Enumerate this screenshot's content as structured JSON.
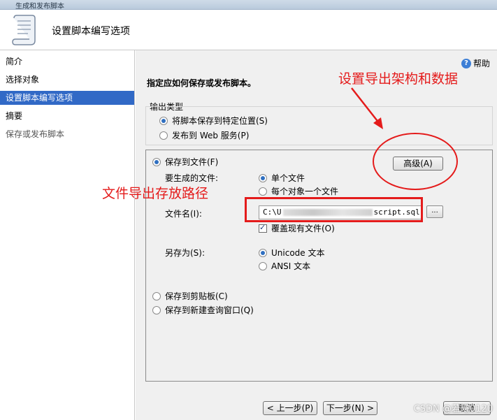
{
  "window": {
    "title": "生成和发布脚本"
  },
  "header": {
    "title": "设置脚本编写选项"
  },
  "sidebar": {
    "items": [
      {
        "label": "简介"
      },
      {
        "label": "选择对象"
      },
      {
        "label": "设置脚本编写选项"
      },
      {
        "label": "摘要"
      },
      {
        "label": "保存或发布脚本"
      }
    ]
  },
  "main": {
    "help_label": "帮助",
    "instruction": "指定应如何保存或发布脚本。",
    "output_type": {
      "label": "输出类型",
      "option_save": "将脚本保存到特定位置(S)",
      "option_publish": "发布到 Web 服务(P)"
    },
    "save_to_file": "保存到文件(F)",
    "advanced_button": "高级(A)",
    "files_to_generate_label": "要生成的文件:",
    "single_file": "单个文件",
    "file_per_object": "每个对象一个文件",
    "filename_label": "文件名(I):",
    "filename_value_start": "C:\\U",
    "filename_value_end": "script.sql",
    "browse_button": "...",
    "overwrite_label": "覆盖现有文件(O)",
    "save_as_label": "另存为(S):",
    "unicode_option": "Unicode 文本",
    "ansi_option": "ANSI 文本",
    "save_clipboard": "保存到剪贴板(C)",
    "save_new_query": "保存到新建查询窗口(Q)"
  },
  "footer": {
    "prev_button": "< 上一步(P)",
    "next_button": "下一步(N) >",
    "cancel_button": "取消"
  },
  "annotations": {
    "set_export": "设置导出架构和数据",
    "file_path": "文件导出存放路径"
  },
  "watermark": "CSDN @若曦0120",
  "colors": {
    "selection": "#3169c6",
    "annotation": "#e41b1b",
    "panel_bg": "#f0f0f0"
  }
}
